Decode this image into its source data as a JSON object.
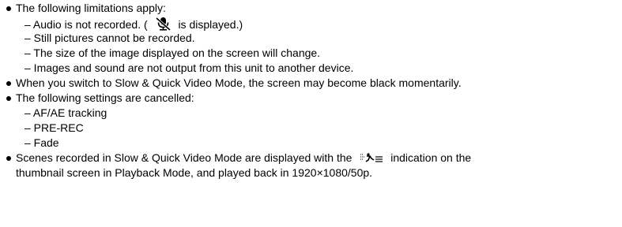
{
  "content": {
    "b1": {
      "text": "The following limitations apply:",
      "items": [
        {
          "before": "– Audio is not recorded. (",
          "icon": "mute-microphone-icon",
          "after": "is displayed.)"
        },
        {
          "text": "– Still pictures cannot be recorded."
        },
        {
          "text": "– The size of the image displayed on the screen will change."
        },
        {
          "text": "– Images and sound are not output from this unit to another device."
        }
      ]
    },
    "b2": {
      "text": "When you switch to Slow & Quick Video Mode, the screen may become black momentarily."
    },
    "b3": {
      "text": "The following settings are cancelled:",
      "items": [
        {
          "text": "– AF/AE tracking"
        },
        {
          "text": "– PRE-REC"
        },
        {
          "text": "– Fade"
        }
      ]
    },
    "b4": {
      "line1_before": "Scenes recorded in Slow & Quick Video Mode are displayed with the",
      "icon": "slow-quick-video-icon",
      "line1_after": "indication on the",
      "line2": "thumbnail screen in Playback Mode, and played back in 1920×1080/50p."
    }
  }
}
